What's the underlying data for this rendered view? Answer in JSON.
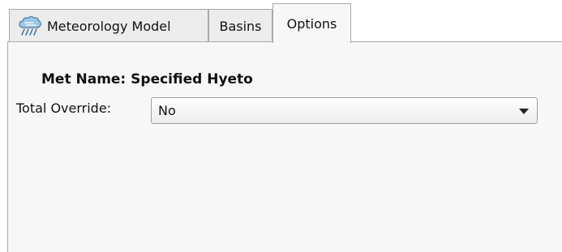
{
  "tabs": {
    "meteorology_model": {
      "label": "Meteorology Model",
      "icon": "rain-cloud-icon"
    },
    "basins": {
      "label": "Basins"
    },
    "options": {
      "label": "Options",
      "selected": true
    }
  },
  "form": {
    "met_name": "Met Name: Specified Hyeto",
    "total_override": {
      "label": "Total Override:",
      "value": "No"
    }
  }
}
